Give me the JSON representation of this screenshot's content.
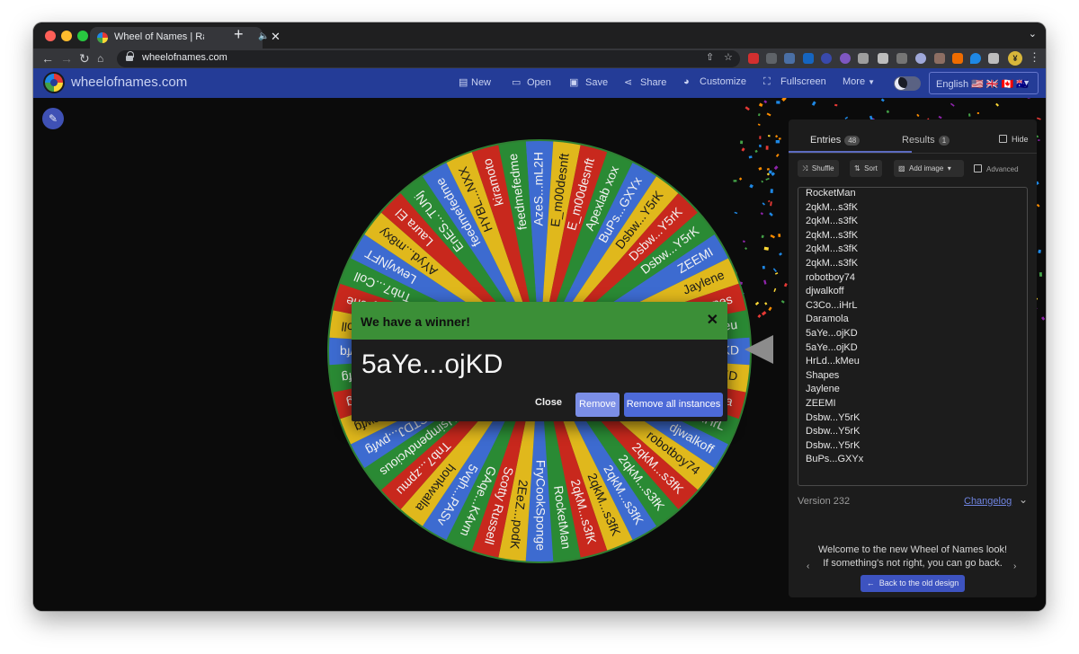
{
  "browser": {
    "tab_title": "Wheel of Names | Random",
    "tab_audio_icon": "speaker-icon",
    "tab_close": "✕",
    "new_tab": "+",
    "url": "wheelofnames.com",
    "traffic_lights": [
      "#fe5f57",
      "#febc2e",
      "#28c840"
    ]
  },
  "header": {
    "brand": "wheelofnames.com",
    "nav": {
      "new": "New",
      "open": "Open",
      "save": "Save",
      "share": "Share",
      "customize": "Customize",
      "fullscreen": "Fullscreen",
      "more": "More"
    },
    "language": "English 🇺🇸 🇬🇧 🇨🇦 🇦🇺",
    "brand_color": "#243c97"
  },
  "wheel": {
    "segment_colors": [
      "#3d6bd0",
      "#e0b81c",
      "#c8281d",
      "#2a8a34"
    ],
    "rim_color": "#2f8033",
    "segments": [
      "AzeS...mL2H",
      "E_m00desnft",
      "E_m00desnft",
      "Apexlab xox",
      "BuPs...GXYx",
      "Dsbw...Y5rK",
      "Dsbw...Y5rK",
      "Dsbw...Y5rK",
      "ZEEMI",
      "Jaylene",
      "Shapes",
      "HrLd...kMeu",
      "5aYe...ojKD",
      "5aYe...ojKD",
      "Daramola",
      "C3Co...iHrL",
      "djwalkoff",
      "robotboy74",
      "2qkM...s3fK",
      "2qkM...s3fK",
      "2qkM...s3fK",
      "2qkM...s3fK",
      "2qkM...s3fK",
      "RocketMan",
      "FryCookSponge",
      "2EeZ...podK",
      "Scotty Russell",
      "GAqe...K4vm",
      "5vqh...PASv",
      "honkwalla",
      "Tnb7...zpmu",
      "Hsimpendvcious",
      "CTDJ...pwfg",
      "HWmJ...pwfg",
      "HWmJ...pwfg",
      "HWmJ...pwfg",
      "CTDJ...pwfq",
      "Tnb7...Coll",
      "Jaylene",
      "Tnb7...Coll",
      "LewvjNFT",
      "AYyd...m8xy",
      "Laura El",
      "EnES...TUNj",
      "feedmefedme",
      "HYBL...NXX",
      "kiramoto",
      "feedmefedme"
    ]
  },
  "dialog": {
    "title": "We have a winner!",
    "close_x": "✕",
    "winner": "5aYe...ojKD",
    "close": "Close",
    "remove": "Remove",
    "remove_all": "Remove all instances",
    "header_color": "#3b8f37"
  },
  "panel": {
    "tab_entries": "Entries",
    "entries_count": "48",
    "tab_results": "Results",
    "results_count": "1",
    "hide": "Hide",
    "shuffle": "Shuffle",
    "sort": "Sort",
    "add_image": "Add image",
    "advanced": "Advanced",
    "entries": [
      "RocketMan",
      "2qkM...s3fK",
      "2qkM...s3fK",
      "2qkM...s3fK",
      "2qkM...s3fK",
      "2qkM...s3fK",
      "robotboy74",
      "djwalkoff",
      "C3Co...iHrL",
      "Daramola",
      "5aYe...ojKD",
      "5aYe...ojKD",
      "HrLd...kMeu",
      "Shapes",
      "Jaylene",
      "ZEEMI",
      "Dsbw...Y5rK",
      "Dsbw...Y5rK",
      "Dsbw...Y5rK",
      "BuPs...GXYx"
    ],
    "version": "Version 232",
    "changelog": "Changelog",
    "welcome_line1": "Welcome to the new Wheel of Names look!",
    "welcome_line2": "If something's not right, you can go back.",
    "back_button": "Back to the old design"
  }
}
